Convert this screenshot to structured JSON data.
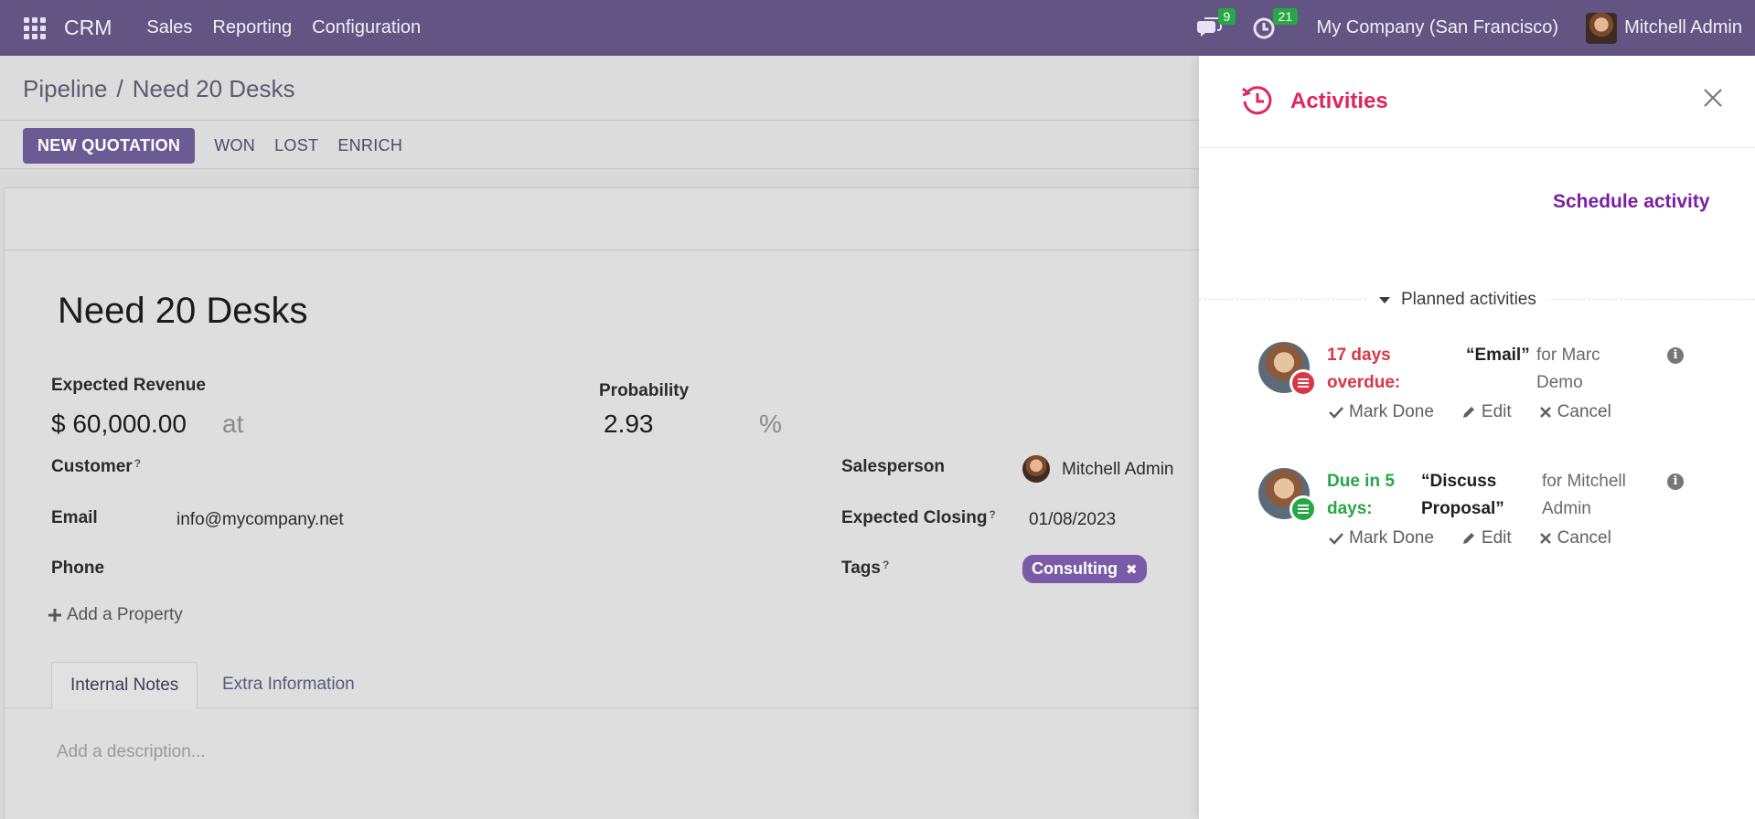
{
  "navbar": {
    "app_name": "CRM",
    "menu": [
      "Sales",
      "Reporting",
      "Configuration"
    ],
    "messages_count": "9",
    "activities_count": "21",
    "company": "My Company (San Francisco)",
    "user": "Mitchell Admin"
  },
  "breadcrumb": {
    "parent": "Pipeline",
    "separator": "/",
    "current": "Need 20 Desks"
  },
  "buttons": {
    "new_quotation": "NEW QUOTATION",
    "won": "WON",
    "lost": "LOST",
    "enrich": "ENRICH"
  },
  "form": {
    "title": "Need 20 Desks",
    "expected_revenue_label": "Expected Revenue",
    "expected_revenue": "$ 60,000.00",
    "at": "at",
    "probability_label": "Probability",
    "probability": "2.93",
    "percent": "%",
    "customer_label": "Customer",
    "email_label": "Email",
    "email": "info@mycompany.net",
    "phone_label": "Phone",
    "salesperson_label": "Salesperson",
    "salesperson": "Mitchell Admin",
    "expected_closing_label": "Expected Closing",
    "expected_closing": "01/08/2023",
    "tags_label": "Tags",
    "tag": "Consulting",
    "tag_remove": "✖",
    "help_mark": "?",
    "add_property": "Add a Property",
    "tabs": [
      "Internal Notes",
      "Extra Information"
    ],
    "description_placeholder": "Add a description..."
  },
  "panel": {
    "title": "Activities",
    "schedule": "Schedule activity",
    "planned": "Planned activities",
    "activities": [
      {
        "due_line1": "17 days",
        "due_line2": "overdue:",
        "summary": "“Email”",
        "assignee_line1": "for Marc",
        "assignee_line2": "Demo",
        "color": "#dc3545",
        "mark_done": "Mark Done",
        "edit": "Edit",
        "cancel": "Cancel"
      },
      {
        "due_line1": "Due in 5",
        "due_line2": "days:",
        "summary_line1": "“Discuss",
        "summary_line2": "Proposal”",
        "assignee_line1": "for Mitchell",
        "assignee_line2": "Admin",
        "color": "#28a745",
        "mark_done": "Mark Done",
        "edit": "Edit",
        "cancel": "Cancel"
      }
    ]
  }
}
